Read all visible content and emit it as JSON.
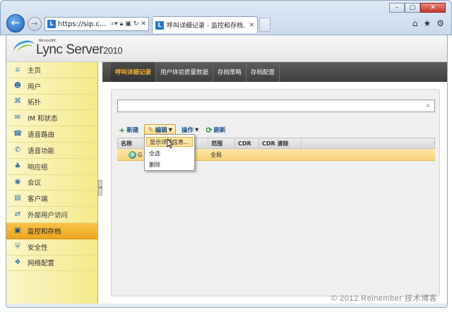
{
  "browser": {
    "address": "https://sip.c...",
    "tab_title": "呼叫详细记录 - 监控和存档...",
    "window_controls": [
      "minimize",
      "maximize",
      "close"
    ],
    "tool_icons": [
      "home-icon",
      "star-icon",
      "gear-icon"
    ]
  },
  "app": {
    "logo_small": "Microsoft®",
    "logo_main": "Lync Server",
    "logo_year": "2010"
  },
  "sidebar": {
    "items": [
      {
        "label": "主页",
        "icon": "home-icon"
      },
      {
        "label": "用户",
        "icon": "users-icon"
      },
      {
        "label": "拓扑",
        "icon": "topology-icon"
      },
      {
        "label": "IM 和状态",
        "icon": "chat-icon"
      },
      {
        "label": "语音路由",
        "icon": "phone-route-icon"
      },
      {
        "label": "语音功能",
        "icon": "phone-icon"
      },
      {
        "label": "响应组",
        "icon": "group-icon"
      },
      {
        "label": "会议",
        "icon": "conference-icon"
      },
      {
        "label": "客户端",
        "icon": "client-icon"
      },
      {
        "label": "外部用户访问",
        "icon": "external-icon"
      },
      {
        "label": "监控和存档",
        "icon": "monitor-icon",
        "active": true
      },
      {
        "label": "安全性",
        "icon": "security-icon"
      },
      {
        "label": "网络配置",
        "icon": "network-icon"
      }
    ]
  },
  "content_tabs": [
    {
      "label": "呼叫详细记录",
      "active": true
    },
    {
      "label": "用户体验质量数据"
    },
    {
      "label": "存档策略"
    },
    {
      "label": "存档配置"
    }
  ],
  "search": {
    "value": "",
    "placeholder": ""
  },
  "toolbar": {
    "new_label": "新建",
    "edit_label": "编辑",
    "action_label": "操作",
    "refresh_label": "刷新"
  },
  "grid": {
    "columns": [
      "名称",
      "范围",
      "CDR",
      "CDR 清除"
    ],
    "rows": [
      {
        "name": "G",
        "scope": "全局",
        "cdr": "",
        "cdr_purge": ""
      }
    ]
  },
  "edit_menu": {
    "items": [
      "显示详细信息...",
      "全选",
      "删除"
    ]
  },
  "watermark": "© 2012 Reinember 技术博客"
}
